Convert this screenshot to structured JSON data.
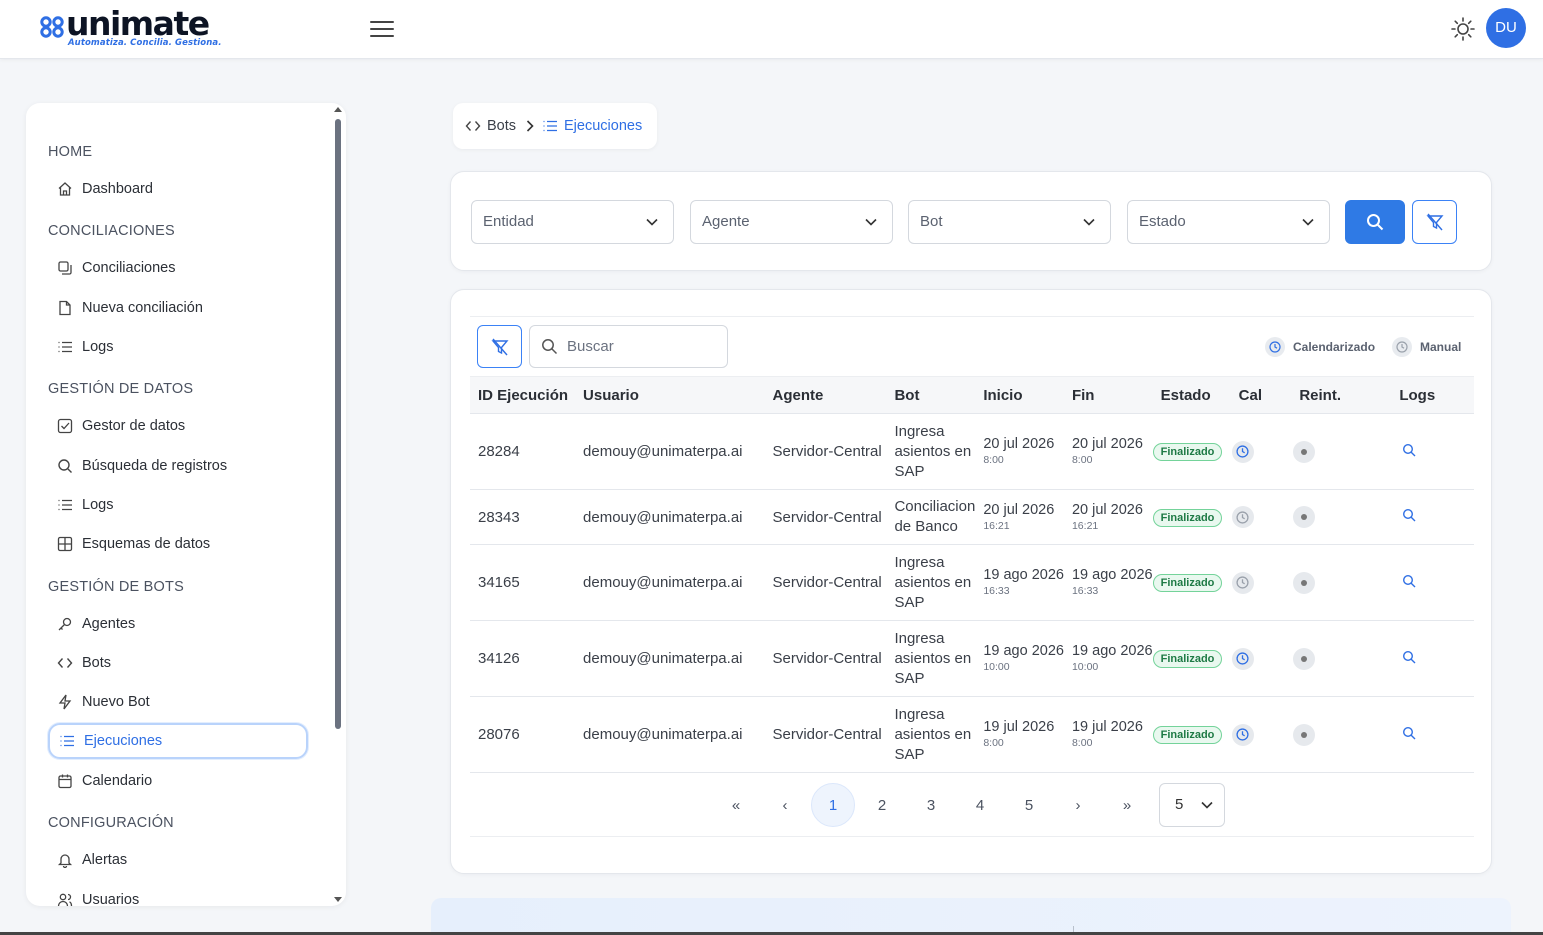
{
  "brand": {
    "name": "unimate",
    "tagline": "Automatiza. Concilia. Gestiona.",
    "accent_color": "#2f6fe4"
  },
  "header": {
    "theme_icon": "sun-icon",
    "avatar_initials": "DU"
  },
  "sidebar": {
    "sections": [
      {
        "title": "HOME",
        "items": [
          {
            "label": "Dashboard",
            "icon": "home-icon"
          }
        ]
      },
      {
        "title": "CONCILIACIONES",
        "items": [
          {
            "label": "Conciliaciones",
            "icon": "copy-icon"
          },
          {
            "label": "Nueva conciliación",
            "icon": "file-icon"
          },
          {
            "label": "Logs",
            "icon": "list-icon"
          }
        ]
      },
      {
        "title": "GESTIÓN DE DATOS",
        "items": [
          {
            "label": "Gestor de datos",
            "icon": "checkbox-icon"
          },
          {
            "label": "Búsqueda de registros",
            "icon": "search-icon"
          },
          {
            "label": "Logs",
            "icon": "list-icon"
          },
          {
            "label": "Esquemas de datos",
            "icon": "table-icon"
          }
        ]
      },
      {
        "title": "GESTIÓN DE BOTS",
        "items": [
          {
            "label": "Agentes",
            "icon": "key-icon"
          },
          {
            "label": "Bots",
            "icon": "code-icon"
          },
          {
            "label": "Nuevo Bot",
            "icon": "bolt-icon"
          },
          {
            "label": "Ejecuciones",
            "icon": "list-icon",
            "active": true
          },
          {
            "label": "Calendario",
            "icon": "calendar-icon"
          }
        ]
      },
      {
        "title": "CONFIGURACIÓN",
        "items": [
          {
            "label": "Alertas",
            "icon": "bell-icon"
          },
          {
            "label": "Usuarios",
            "icon": "users-icon"
          }
        ]
      }
    ]
  },
  "breadcrumb": {
    "items": [
      {
        "label": "Bots",
        "icon": "code-icon"
      },
      {
        "label": "Ejecuciones",
        "icon": "list-icon"
      }
    ]
  },
  "filters": {
    "entidad": "Entidad",
    "agente": "Agente",
    "bot": "Bot",
    "estado": "Estado"
  },
  "table": {
    "search_placeholder": "Buscar",
    "legend": {
      "scheduled": "Calendarizado",
      "manual": "Manual"
    },
    "columns": [
      "ID Ejecución",
      "Usuario",
      "Agente",
      "Bot",
      "Inicio",
      "Fin",
      "Estado",
      "Cal",
      "Reint.",
      "Logs"
    ],
    "rows": [
      {
        "id": "28284",
        "user": "demouy@unimaterpa.ai",
        "agent": "Servidor-Central",
        "bot": "Ingresa asientos en SAP",
        "start_date": "20 jul 2026",
        "start_time": "8:00",
        "end_date": "20 jul 2026",
        "end_time": "8:00",
        "status": "Finalizado",
        "scheduled": true
      },
      {
        "id": "28343",
        "user": "demouy@unimaterpa.ai",
        "agent": "Servidor-Central",
        "bot": "Conciliacion de Banco",
        "start_date": "20 jul 2026",
        "start_time": "16:21",
        "end_date": "20 jul 2026",
        "end_time": "16:21",
        "status": "Finalizado",
        "scheduled": false
      },
      {
        "id": "34165",
        "user": "demouy@unimaterpa.ai",
        "agent": "Servidor-Central",
        "bot": "Ingresa asientos en SAP",
        "start_date": "19 ago 2026",
        "start_time": "16:33",
        "end_date": "19 ago 2026",
        "end_time": "16:33",
        "status": "Finalizado",
        "scheduled": false
      },
      {
        "id": "34126",
        "user": "demouy@unimaterpa.ai",
        "agent": "Servidor-Central",
        "bot": "Ingresa asientos en SAP",
        "start_date": "19 ago 2026",
        "start_time": "10:00",
        "end_date": "19 ago 2026",
        "end_time": "10:00",
        "status": "Finalizado",
        "scheduled": true
      },
      {
        "id": "28076",
        "user": "demouy@unimaterpa.ai",
        "agent": "Servidor-Central",
        "bot": "Ingresa asientos en SAP",
        "start_date": "19 jul 2026",
        "start_time": "8:00",
        "end_date": "19 jul 2026",
        "end_time": "8:00",
        "status": "Finalizado",
        "scheduled": true
      }
    ]
  },
  "pagination": {
    "first": "«",
    "prev": "‹",
    "pages": [
      "1",
      "2",
      "3",
      "4",
      "5"
    ],
    "current": "1",
    "next": "›",
    "last": "»",
    "page_size": "5"
  }
}
